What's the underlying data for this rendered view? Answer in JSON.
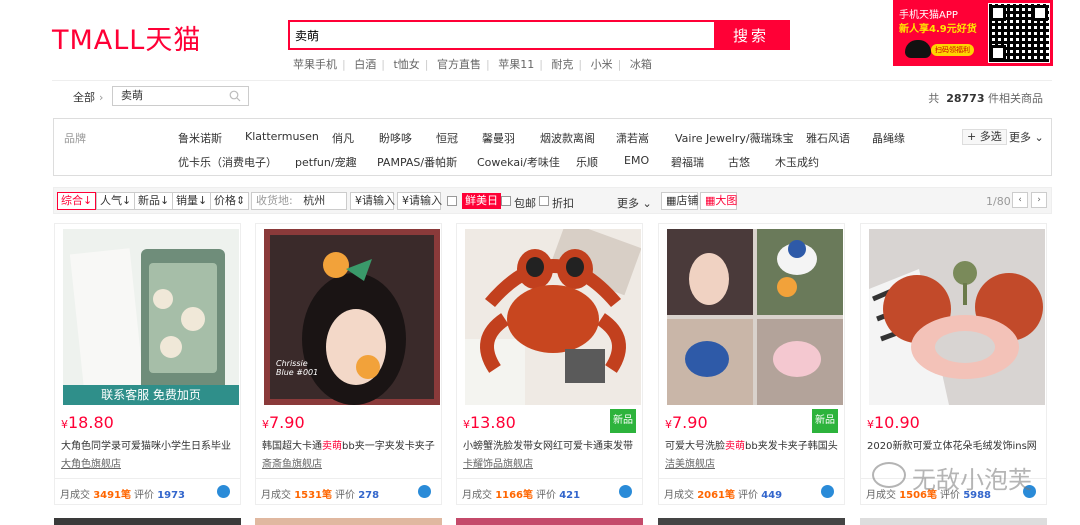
{
  "header": {
    "logo": "TMALL天猫",
    "search_value": "卖萌",
    "search_button": "搜索",
    "hotwords": [
      "苹果手机",
      "白酒",
      "t恤女",
      "官方直售",
      "苹果11",
      "耐克",
      "小米",
      "冰箱"
    ],
    "app_banner": {
      "line1": "手机天猫APP",
      "line2": "新人享4.9元好货",
      "scan": "扫码领福利"
    }
  },
  "breadcrumb": {
    "all": "全部",
    "query": "卖萌",
    "count_prefix": "共",
    "count": "28773",
    "count_suffix": "件相关商品"
  },
  "brands": {
    "label": "品牌",
    "row1": [
      "鲁米诺斯",
      "Klattermusen",
      "俏凡",
      "盼哆哆",
      "恒冠",
      "馨曼羽",
      "烟波款离阁",
      "潇若嵩",
      "Vaire Jewelry/薇瑞珠宝",
      "雅石风语",
      "晶绳缘"
    ],
    "row2": [
      "优卡乐（消费电子）",
      "petfun/宠趣",
      "PAMPAS/番帕斯",
      "Cowekai/考味佳",
      "乐顺",
      "EMO",
      "碧福瑞",
      "古悠",
      "木玉成约"
    ],
    "multi": "+ 多选",
    "more": "更多"
  },
  "filter": {
    "sort": [
      "综合",
      "人气",
      "新品",
      "销量",
      "价格"
    ],
    "location_label": "收货地:",
    "location_value": "杭州",
    "price_from": "¥请输入",
    "price_to": "¥请输入",
    "tag_fresh": "鲜美日",
    "free_shipping": "包邮",
    "discount": "折扣",
    "more": "更多",
    "view_shop": "店铺",
    "view_big": "大图",
    "page": "1/80"
  },
  "products": [
    {
      "price": "18.80",
      "title_pre": "大角色同学录可爱猫咪小学生日系毕业",
      "title_hl": "",
      "title_post": "",
      "shop": "大角色旗舰店",
      "sales": "3491笔",
      "reviews": "1973",
      "new": false,
      "img_label": "联系客服  免费加页"
    },
    {
      "price": "7.90",
      "title_pre": "韩国超大卡通",
      "title_hl": "卖萌",
      "title_post": "bb夹一字夹发卡夹子",
      "shop": "斎斎鱼旗舰店",
      "sales": "1531笔",
      "reviews": "278",
      "new": false,
      "img_label": "Chrissie Blue #001"
    },
    {
      "price": "13.80",
      "title_pre": "小螃蟹洗脸发带女网红可爱卡通束发带",
      "title_hl": "",
      "title_post": "",
      "shop": "卡耀饰品旗舰店",
      "sales": "1166笔",
      "reviews": "421",
      "new": true,
      "img_label": ""
    },
    {
      "price": "7.90",
      "title_pre": "可爱大号洗脸",
      "title_hl": "卖萌",
      "title_post": "bb夹发卡夹子韩国头",
      "shop": "洁美旗舰店",
      "sales": "2061笔",
      "reviews": "449",
      "new": true,
      "img_label": ""
    },
    {
      "price": "10.90",
      "title_pre": "2020新款可爱立体花朵毛绒发饰ins网",
      "title_hl": "",
      "title_post": "",
      "shop": "",
      "sales": "1506笔",
      "reviews": "5988",
      "new": false,
      "img_label": ""
    }
  ],
  "labels": {
    "new_tag": "新品",
    "monthly_sales": "月成交",
    "reviews": "评价",
    "currency": "¥"
  },
  "watermark": "无敌小泡芙",
  "colors": {
    "brand": "#ff0036",
    "green_tag": "#2db33c"
  }
}
